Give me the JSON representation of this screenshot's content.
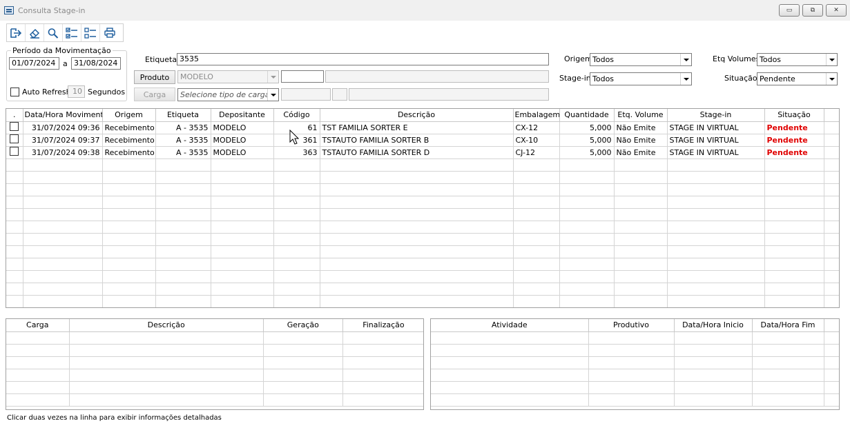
{
  "window": {
    "title": "Consulta Stage-in",
    "minimize_glyph": "▭",
    "maximize_glyph": "⧉",
    "close_glyph": "✕"
  },
  "toolbar": {
    "icons": [
      "exit-icon",
      "eraser-icon",
      "search-icon",
      "check-list-icon",
      "uncheck-list-icon",
      "printer-icon"
    ]
  },
  "period": {
    "legend": "Período da Movimentação",
    "from": "01/07/2024",
    "separator": "a",
    "to": "31/08/2024",
    "auto_refresh_label": "Auto Refresh",
    "auto_refresh_value": "10",
    "seconds_label": "Segundos"
  },
  "filters": {
    "etiqueta_label": "Etiqueta",
    "etiqueta_value": "3535",
    "produto_button": "Produto",
    "produto_value": "MODELO",
    "carga_button": "Carga",
    "carga_placeholder": "Selecione tipo de carga",
    "origem_label": "Origem",
    "origem_value": "Todos",
    "stagein_label": "Stage-in",
    "stagein_value": "Todos",
    "etq_volumes_label": "Etq Volumes",
    "etq_volumes_value": "Todos",
    "situacao_label": "Situação",
    "situacao_value": "Pendente"
  },
  "main_grid": {
    "columns": [
      ".",
      "Data/Hora Movimento",
      "Origem",
      "Etiqueta",
      "Depositante",
      "Código",
      "Descrição",
      "Embalagem",
      "Quantidade",
      "Etq. Volume",
      "Stage-in",
      "Situação"
    ],
    "rows": [
      {
        "data_hora": "31/07/2024 09:36",
        "origem": "Recebimento",
        "etiqueta": "A - 3535",
        "depositante": "MODELO",
        "codigo": "61",
        "descricao": "TST FAMILIA SORTER E",
        "embalagem": "CX-12",
        "quantidade": "5,000",
        "etq_volume": "Não Emite",
        "stage_in": "STAGE IN VIRTUAL",
        "situacao": "Pendente"
      },
      {
        "data_hora": "31/07/2024 09:37",
        "origem": "Recebimento",
        "etiqueta": "A - 3535",
        "depositante": "MODELO",
        "codigo": "361",
        "descricao": "TSTAUTO FAMILIA SORTER B",
        "embalagem": "CX-10",
        "quantidade": "5,000",
        "etq_volume": "Não Emite",
        "stage_in": "STAGE IN VIRTUAL",
        "situacao": "Pendente"
      },
      {
        "data_hora": "31/07/2024 09:38",
        "origem": "Recebimento",
        "etiqueta": "A - 3535",
        "depositante": "MODELO",
        "codigo": "363",
        "descricao": "TSTAUTO FAMILIA SORTER D",
        "embalagem": "CJ-12",
        "quantidade": "5,000",
        "etq_volume": "Não Emite",
        "stage_in": "STAGE IN VIRTUAL",
        "situacao": "Pendente"
      }
    ],
    "status_color": "#e00000"
  },
  "carga_grid": {
    "columns": [
      "Carga",
      "Descrição",
      "Geração",
      "Finalização"
    ]
  },
  "atividade_grid": {
    "columns": [
      "Atividade",
      "Produtivo",
      "Data/Hora Inicio",
      "Data/Hora Fim"
    ]
  },
  "status_bar": {
    "text": "Clicar duas vezes na linha para exibir informações detalhadas"
  }
}
